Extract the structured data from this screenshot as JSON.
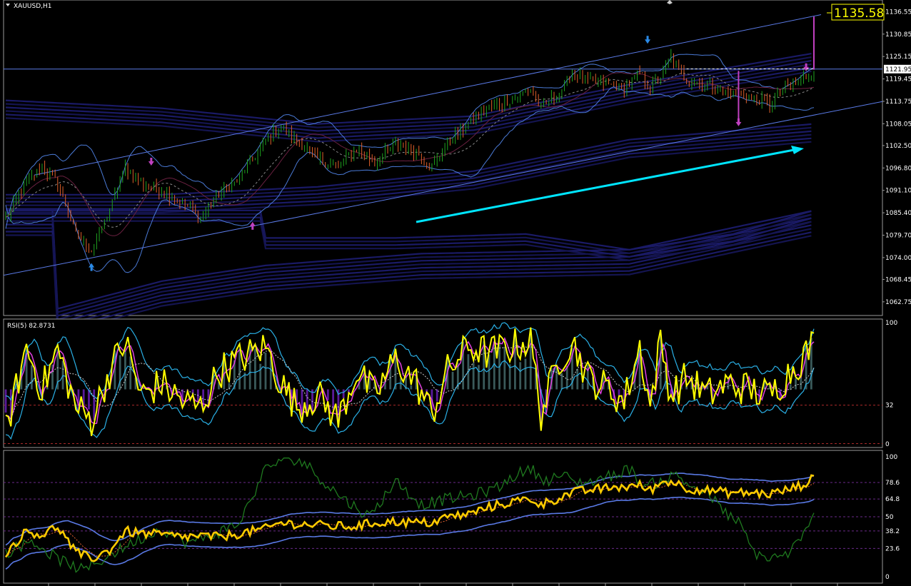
{
  "chart_data": [
    {
      "type": "line",
      "panel": "price",
      "title": "XAUUSD,H1",
      "ylim": [
        1060.0,
        1138.8
      ],
      "ticks": [
        "1136.55",
        "1130.85",
        "1125.15",
        "1119.45",
        "1113.75",
        "1108.05",
        "1102.50",
        "1096.80",
        "1091.10",
        "1085.40",
        "1079.70",
        "1074.00",
        "1068.45",
        "1062.75"
      ],
      "tick_values": [
        1136.55,
        1130.85,
        1125.15,
        1119.45,
        1113.75,
        1108.05,
        1102.5,
        1096.8,
        1091.1,
        1085.4,
        1079.7,
        1074.0,
        1068.45,
        1062.75
      ],
      "current_label": "1121.95",
      "current_value": 1121.95,
      "big_price_label": "1135.58",
      "big_price_value": 1135.58,
      "close_anchors": [
        [
          0,
          1084
        ],
        [
          8,
          1093
        ],
        [
          14,
          1097
        ],
        [
          20,
          1093
        ],
        [
          27,
          1080
        ],
        [
          33,
          1076
        ],
        [
          40,
          1086
        ],
        [
          46,
          1097
        ],
        [
          52,
          1093
        ],
        [
          60,
          1091
        ],
        [
          68,
          1088
        ],
        [
          75,
          1084
        ],
        [
          82,
          1090
        ],
        [
          90,
          1094
        ],
        [
          100,
          1104
        ],
        [
          106,
          1107
        ],
        [
          112,
          1104
        ],
        [
          120,
          1099
        ],
        [
          128,
          1097
        ],
        [
          135,
          1102
        ],
        [
          142,
          1098
        ],
        [
          150,
          1103
        ],
        [
          158,
          1101
        ],
        [
          164,
          1097
        ],
        [
          170,
          1103
        ],
        [
          178,
          1108
        ],
        [
          186,
          1112
        ],
        [
          194,
          1114
        ],
        [
          202,
          1117
        ],
        [
          206,
          1112
        ],
        [
          213,
          1116
        ],
        [
          218,
          1121
        ],
        [
          224,
          1119
        ],
        [
          232,
          1118
        ],
        [
          238,
          1117
        ],
        [
          244,
          1121
        ],
        [
          248,
          1117
        ],
        [
          252,
          1120
        ],
        [
          256,
          1125
        ],
        [
          262,
          1119
        ],
        [
          270,
          1118
        ],
        [
          278,
          1116
        ],
        [
          286,
          1115
        ],
        [
          294,
          1113
        ],
        [
          300,
          1117
        ],
        [
          306,
          1119
        ],
        [
          311,
          1121.95
        ]
      ],
      "overlays": [
        "channel-upper",
        "channel-lower",
        "bollinger-bands",
        "ma-bands",
        "trend-arrow"
      ]
    },
    {
      "type": "line",
      "panel": "oscillator",
      "title": "RSI(5) 82.8731",
      "ylim": [
        0,
        100
      ],
      "ticks": [
        "100",
        "32",
        "0"
      ],
      "tick_values": [
        100,
        32,
        0
      ],
      "levels": [
        32
      ],
      "series": [
        {
          "name": "",
          "color": "#ffff00",
          "anchors": [
            [
              0,
              10
            ],
            [
              8,
              80
            ],
            [
              14,
              45
            ],
            [
              20,
              78
            ],
            [
              27,
              30
            ],
            [
              33,
              20
            ],
            [
              40,
              60
            ],
            [
              46,
              85
            ],
            [
              52,
              40
            ],
            [
              60,
              50
            ],
            [
              68,
              35
            ],
            [
              75,
              30
            ],
            [
              82,
              60
            ],
            [
              90,
              70
            ],
            [
              100,
              80
            ],
            [
              106,
              50
            ],
            [
              112,
              30
            ],
            [
              120,
              40
            ],
            [
              128,
              20
            ],
            [
              135,
              60
            ],
            [
              142,
              40
            ],
            [
              150,
              70
            ],
            [
              158,
              50
            ],
            [
              164,
              25
            ],
            [
              170,
              60
            ],
            [
              178,
              80
            ],
            [
              186,
              75
            ],
            [
              194,
              80
            ],
            [
              202,
              85
            ],
            [
              206,
              25
            ],
            [
              213,
              70
            ],
            [
              218,
              85
            ],
            [
              224,
              55
            ],
            [
              232,
              45
            ],
            [
              238,
              35
            ],
            [
              244,
              80
            ],
            [
              248,
              30
            ],
            [
              252,
              85
            ],
            [
              256,
              40
            ],
            [
              262,
              55
            ],
            [
              270,
              40
            ],
            [
              278,
              50
            ],
            [
              286,
              45
            ],
            [
              294,
              40
            ],
            [
              300,
              55
            ],
            [
              306,
              70
            ],
            [
              311,
              82.9
            ]
          ]
        }
      ]
    },
    {
      "type": "line",
      "panel": "stochastic",
      "title": "",
      "ylim": [
        0,
        100
      ],
      "ticks": [
        "100",
        "78.6",
        "64.8",
        "50",
        "38.2",
        "23.6",
        "0"
      ],
      "tick_values": [
        100,
        78.6,
        64.8,
        50,
        38.2,
        23.6,
        0
      ],
      "levels": [
        78.6,
        64.8,
        50,
        38.2,
        23.6
      ],
      "series": [
        {
          "name": "",
          "color": "#ffcc00",
          "anchors": [
            [
              0,
              20
            ],
            [
              8,
              38
            ],
            [
              14,
              35
            ],
            [
              20,
              42
            ],
            [
              27,
              20
            ],
            [
              33,
              15
            ],
            [
              40,
              22
            ],
            [
              46,
              38
            ],
            [
              52,
              36
            ],
            [
              60,
              35
            ],
            [
              68,
              33
            ],
            [
              75,
              34
            ],
            [
              82,
              33
            ],
            [
              90,
              36
            ],
            [
              100,
              40
            ],
            [
              106,
              45
            ],
            [
              112,
              44
            ],
            [
              120,
              43
            ],
            [
              128,
              42
            ],
            [
              135,
              42
            ],
            [
              142,
              45
            ],
            [
              150,
              46
            ],
            [
              158,
              45
            ],
            [
              164,
              45
            ],
            [
              170,
              50
            ],
            [
              178,
              52
            ],
            [
              186,
              58
            ],
            [
              194,
              62
            ],
            [
              202,
              65
            ],
            [
              206,
              60
            ],
            [
              213,
              66
            ],
            [
              218,
              70
            ],
            [
              224,
              72
            ],
            [
              232,
              74
            ],
            [
              238,
              75
            ],
            [
              244,
              76
            ],
            [
              248,
              72
            ],
            [
              252,
              78
            ],
            [
              256,
              80
            ],
            [
              262,
              74
            ],
            [
              270,
              72
            ],
            [
              278,
              70
            ],
            [
              286,
              70
            ],
            [
              294,
              69
            ],
            [
              300,
              72
            ],
            [
              306,
              76
            ],
            [
              311,
              82
            ]
          ]
        },
        {
          "name": "",
          "color": "#1f7a1f",
          "anchors": [
            [
              0,
              20
            ],
            [
              10,
              30
            ],
            [
              20,
              15
            ],
            [
              30,
              5
            ],
            [
              40,
              18
            ],
            [
              50,
              30
            ],
            [
              60,
              40
            ],
            [
              70,
              28
            ],
            [
              80,
              35
            ],
            [
              90,
              45
            ],
            [
              100,
              90
            ],
            [
              108,
              100
            ],
            [
              115,
              95
            ],
            [
              122,
              80
            ],
            [
              130,
              65
            ],
            [
              140,
              50
            ],
            [
              150,
              80
            ],
            [
              160,
              60
            ],
            [
              170,
              65
            ],
            [
              180,
              68
            ],
            [
              190,
              75
            ],
            [
              196,
              85
            ],
            [
              202,
              90
            ],
            [
              208,
              80
            ],
            [
              214,
              85
            ],
            [
              220,
              78
            ],
            [
              226,
              80
            ],
            [
              234,
              85
            ],
            [
              240,
              90
            ],
            [
              246,
              75
            ],
            [
              252,
              80
            ],
            [
              258,
              85
            ],
            [
              264,
              75
            ],
            [
              270,
              70
            ],
            [
              276,
              55
            ],
            [
              282,
              45
            ],
            [
              288,
              20
            ],
            [
              294,
              15
            ],
            [
              300,
              18
            ],
            [
              306,
              30
            ],
            [
              311,
              50
            ]
          ]
        }
      ]
    }
  ]
}
